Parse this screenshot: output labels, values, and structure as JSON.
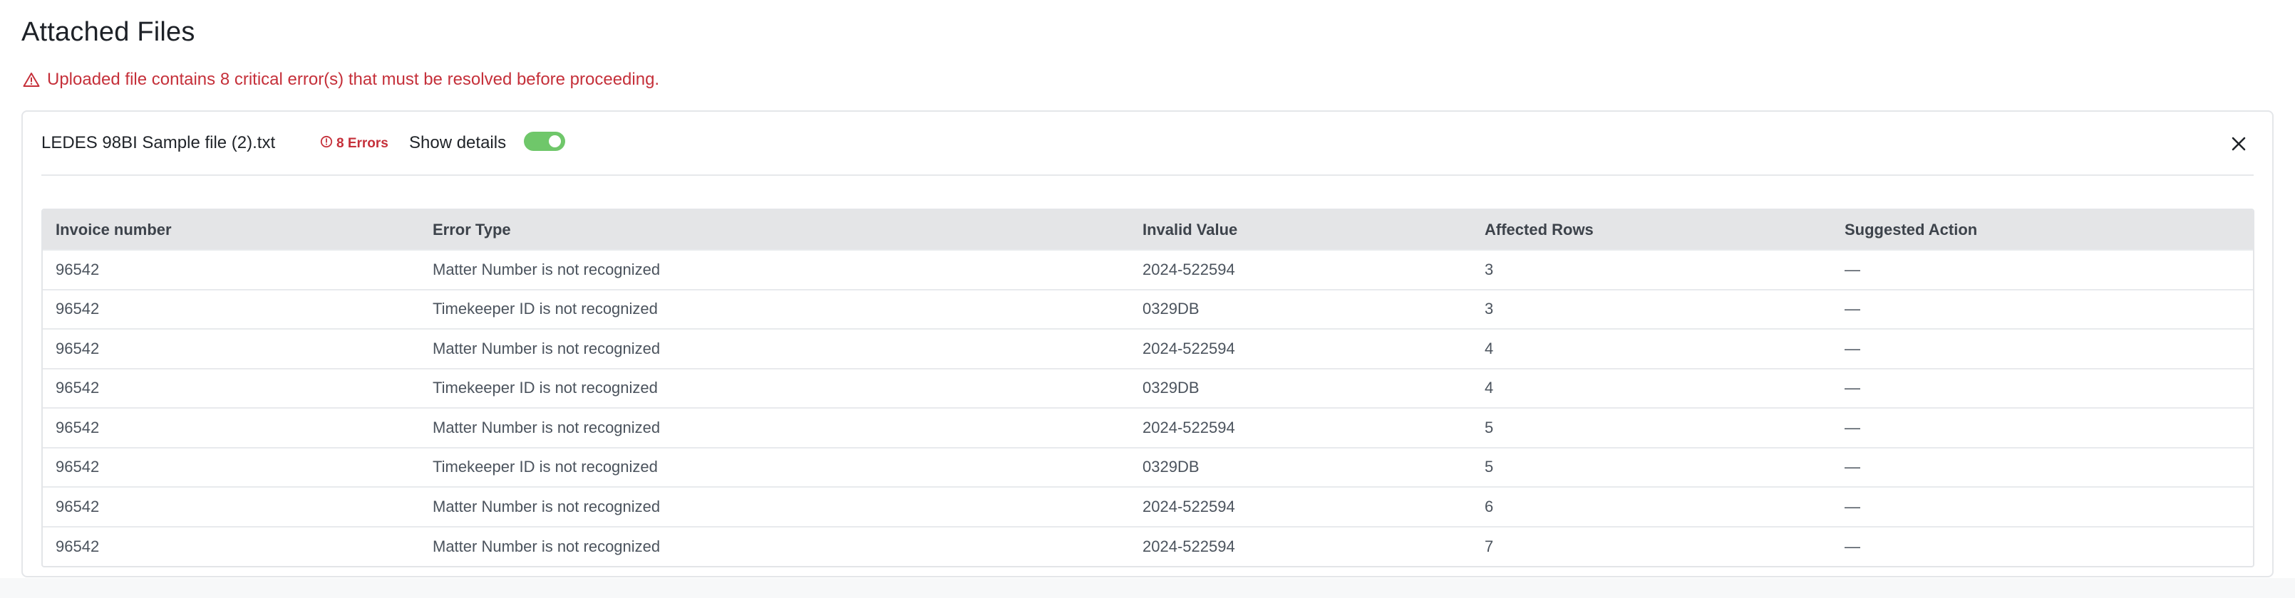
{
  "section": {
    "title": "Attached Files"
  },
  "alert": {
    "icon": "warning-triangle-icon",
    "message": "Uploaded file contains 8 critical error(s) that must be resolved before proceeding.",
    "color": "#c5303a"
  },
  "file": {
    "name": "LEDES 98BI Sample file (2).txt",
    "error_badge": "8 Errors",
    "show_details_label": "Show details",
    "show_details_on": true,
    "toggle_color": "#6fc76a"
  },
  "table": {
    "columns": [
      "Invoice number",
      "Error Type",
      "Invalid Value",
      "Affected Rows",
      "Suggested Action"
    ],
    "rows": [
      [
        "96542",
        "Matter Number is not recognized",
        "2024-522594",
        "3",
        "—"
      ],
      [
        "96542",
        "Timekeeper ID is not recognized",
        "0329DB",
        "3",
        "—"
      ],
      [
        "96542",
        "Matter Number is not recognized",
        "2024-522594",
        "4",
        "—"
      ],
      [
        "96542",
        "Timekeeper ID is not recognized",
        "0329DB",
        "4",
        "—"
      ],
      [
        "96542",
        "Matter Number is not recognized",
        "2024-522594",
        "5",
        "—"
      ],
      [
        "96542",
        "Timekeeper ID is not recognized",
        "0329DB",
        "5",
        "—"
      ],
      [
        "96542",
        "Matter Number is not recognized",
        "2024-522594",
        "6",
        "—"
      ],
      [
        "96542",
        "Matter Number is not recognized",
        "2024-522594",
        "7",
        "—"
      ]
    ]
  }
}
